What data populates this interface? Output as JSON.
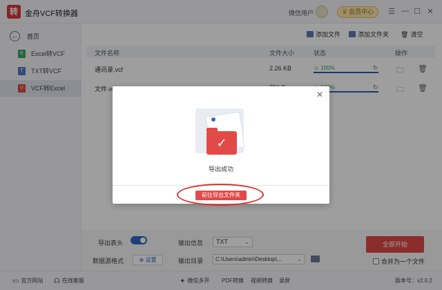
{
  "app": {
    "title": "金舟VCF转换器",
    "wechat_user": "微信用户",
    "member_label": "会员中心",
    "window_controls": {
      "menu": "☰",
      "minimize": "—",
      "maximize": "☐",
      "close": "✕"
    }
  },
  "sidebar": {
    "home_label": "首页",
    "items": [
      {
        "icon": "E",
        "label": "Excel转VCF",
        "color": "#3aa55c"
      },
      {
        "icon": "T",
        "label": "TXT转VCF",
        "color": "#4f79c8"
      },
      {
        "icon": "V",
        "label": "VCF转Excel",
        "color": "#e04a48",
        "active": true
      }
    ]
  },
  "toolbar": {
    "add_file": "添加文件",
    "add_folder": "添加文件夹",
    "clear": "清空"
  },
  "table": {
    "headers": {
      "name": "文件名称",
      "size": "文件大小",
      "status": "状态",
      "action": "操作"
    },
    "rows": [
      {
        "name": "通讯录.vcf",
        "size": "2.26 KB",
        "status": "100%",
        "progress": 1.0
      },
      {
        "name": "文件.vcf",
        "size": "750 B",
        "status": "100%",
        "progress": 1.0
      }
    ]
  },
  "bottom": {
    "export_header_label": "导出表头",
    "export_header_on": true,
    "data_format_label": "数据源格式",
    "settings_label": "设置",
    "output_info_label": "输出信息",
    "output_info_value": "TXT",
    "output_dir_label": "输出目录",
    "output_dir_value": "C:\\Users\\admin\\Desktop\\...",
    "start_label": "全部开始",
    "merge_label": "合并为一个文件"
  },
  "statusbar": {
    "website": "官方网站",
    "service": "在线客服",
    "wechat_multi": "微信多开",
    "pdf": "PDF转换",
    "video": "视频转换",
    "record": "录屏",
    "version": "版本号：v2.0.2"
  },
  "modal": {
    "message": "导出成功",
    "button_label": "前往导出文件夹"
  },
  "colors": {
    "accent_red": "#e04a48",
    "accent_blue": "#2f66c8",
    "success_green": "#2aa357"
  }
}
